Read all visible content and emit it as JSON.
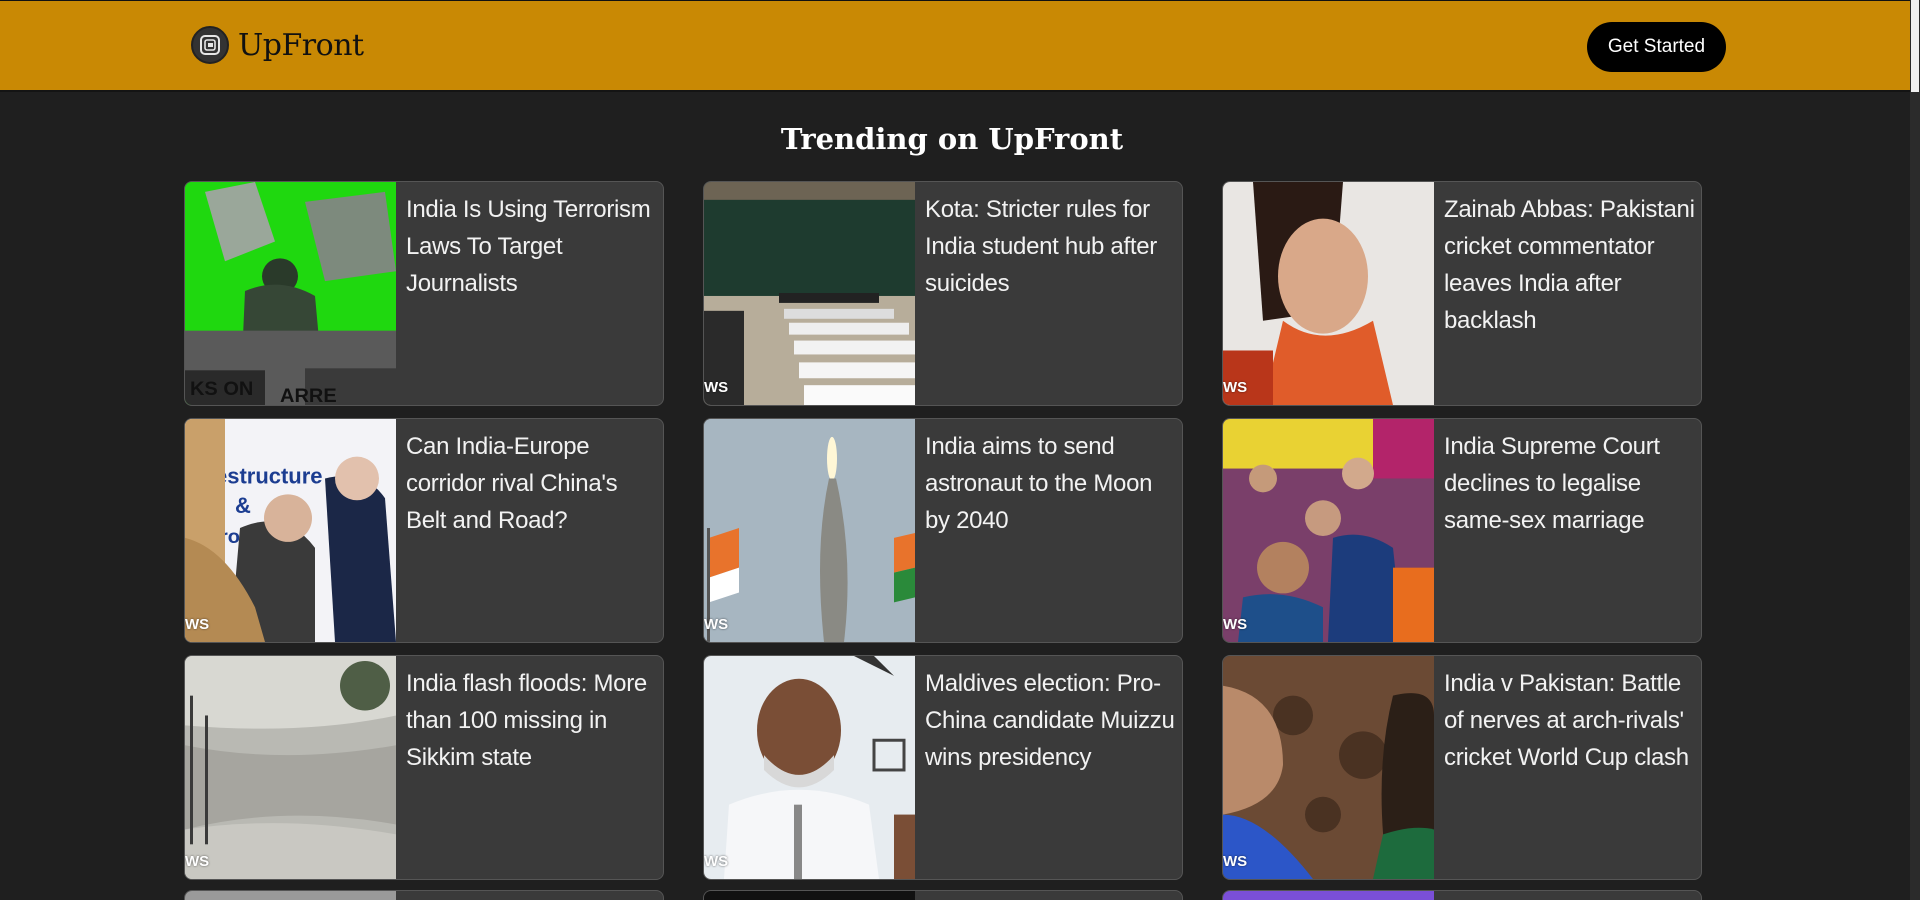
{
  "header": {
    "brand_name": "UpFront",
    "cta_label": "Get Started",
    "background": "#c98904"
  },
  "section": {
    "title": "Trending on UpFront"
  },
  "cards": [
    {
      "title": "India Is Using Terrorism Laws To Target Journalists",
      "tag": ""
    },
    {
      "title": "Kota: Stricter rules for India student hub after suicides",
      "tag": "WS"
    },
    {
      "title": "Zainab Abbas: Pakistani cricket commentator leaves India after backlash",
      "tag": "WS"
    },
    {
      "title": "Can India-Europe corridor rival China's Belt and Road?",
      "tag": "WS"
    },
    {
      "title": "India aims to send astronaut to the Moon by 2040",
      "tag": "WS"
    },
    {
      "title": "India Supreme Court declines to legalise same-sex marriage",
      "tag": "WS"
    },
    {
      "title": "India flash floods: More than 100 missing in Sikkim state",
      "tag": "WS"
    },
    {
      "title": "Maldives election: Pro-China candidate Muizzu wins presidency",
      "tag": "WS"
    },
    {
      "title": "India v Pakistan: Battle of nerves at arch-rivals' cricket World Cup clash",
      "tag": "WS"
    }
  ]
}
